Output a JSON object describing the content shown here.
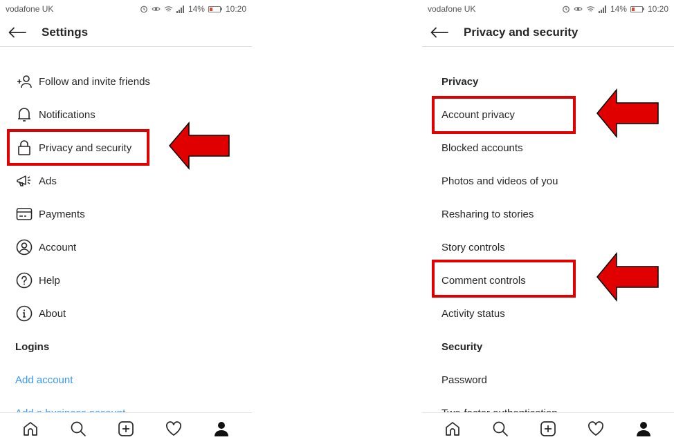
{
  "left_screen": {
    "status": {
      "carrier": "vodafone UK",
      "battery": "14%",
      "time": "10:20"
    },
    "header": {
      "title": "Settings"
    },
    "items": [
      {
        "label": "Follow and invite friends",
        "icon": "add-person-icon"
      },
      {
        "label": "Notifications",
        "icon": "bell-icon"
      },
      {
        "label": "Privacy and security",
        "icon": "lock-icon"
      },
      {
        "label": "Ads",
        "icon": "megaphone-icon"
      },
      {
        "label": "Payments",
        "icon": "card-icon"
      },
      {
        "label": "Account",
        "icon": "account-circle-icon"
      },
      {
        "label": "Help",
        "icon": "help-icon"
      },
      {
        "label": "About",
        "icon": "info-icon"
      }
    ],
    "logins": {
      "label": "Logins"
    },
    "links": [
      {
        "label": "Add account"
      },
      {
        "label": "Add a business account"
      }
    ]
  },
  "right_screen": {
    "status": {
      "carrier": "vodafone UK",
      "battery": "14%",
      "time": "10:20"
    },
    "header": {
      "title": "Privacy and security"
    },
    "section": {
      "label": "Privacy"
    },
    "items": [
      {
        "label": "Account privacy"
      },
      {
        "label": "Blocked accounts"
      },
      {
        "label": "Photos and videos of you"
      },
      {
        "label": "Resharing to stories"
      },
      {
        "label": "Story controls"
      },
      {
        "label": "Comment controls"
      },
      {
        "label": "Activity status"
      }
    ],
    "security": {
      "label": "Security"
    },
    "sec_items": [
      {
        "label": "Password"
      },
      {
        "label": "Two-factor authentication"
      }
    ]
  },
  "tabbar": [
    "home-icon",
    "search-icon",
    "new-post-icon",
    "activity-heart-icon",
    "profile-icon"
  ],
  "colors": {
    "highlight": "#e00000",
    "arrow": "#e00000",
    "link": "#3897f0"
  }
}
